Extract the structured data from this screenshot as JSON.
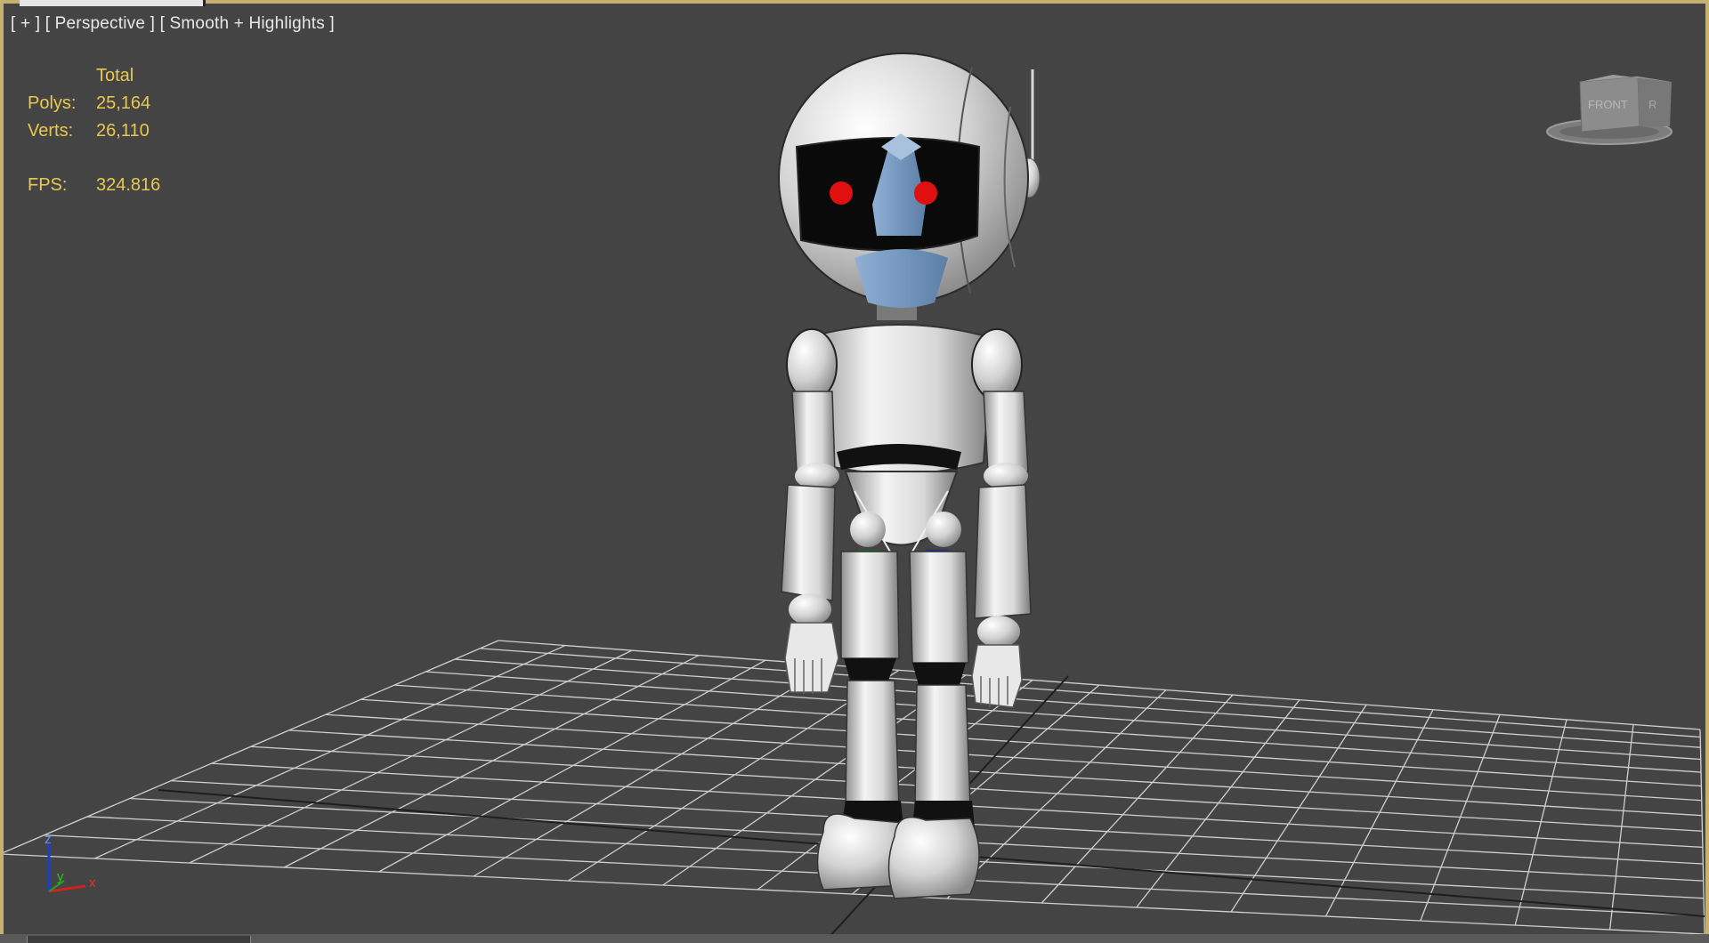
{
  "viewport": {
    "label_plus": "[ + ]",
    "label_view": "[ Perspective ]",
    "label_shading": "[ Smooth + Highlights ]"
  },
  "stats": {
    "header": "Total",
    "polys_label": "Polys:",
    "polys_value": "25,164",
    "verts_label": "Verts:",
    "verts_value": "26,110",
    "fps_label": "FPS:",
    "fps_value": "324.816"
  },
  "viewcube": {
    "face_label": "FRONT",
    "side_label": "R"
  },
  "axis_tripod": {
    "z": "z",
    "y": "y",
    "x": "x"
  },
  "colors": {
    "background": "#444444",
    "grid": "#c8c8c8",
    "stats_text": "#e9c84f",
    "viewport_border": "#c8b070",
    "robot_eyes": "#e01010"
  }
}
